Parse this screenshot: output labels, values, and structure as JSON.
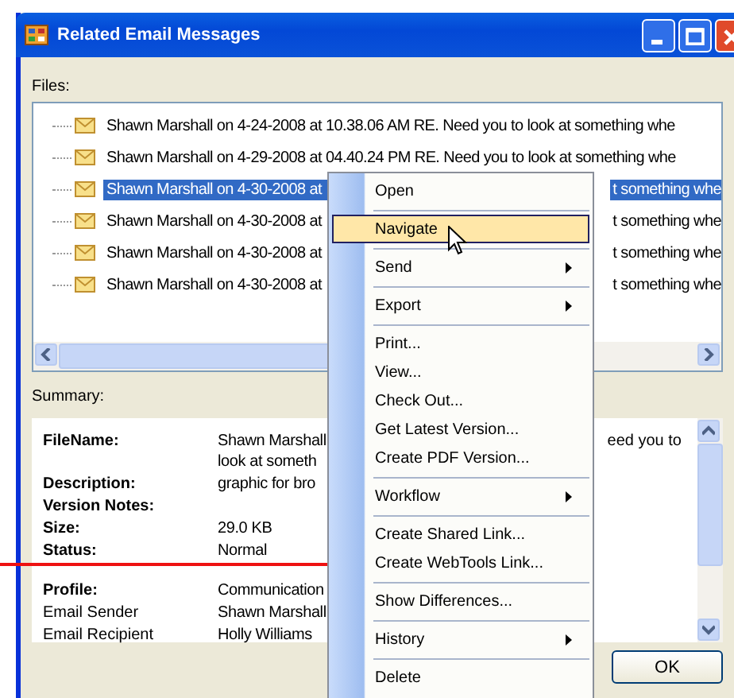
{
  "window": {
    "title": "Related Email Messages"
  },
  "files": {
    "label": "Files:",
    "rows": [
      {
        "text": "Shawn Marshall on 4-24-2008 at 10.38.06 AM RE. Need you to look at something whe",
        "selected": false
      },
      {
        "text": "Shawn Marshall on 4-29-2008 at 04.40.24 PM RE. Need you to look at something whe",
        "selected": false
      },
      {
        "text": "Shawn Marshall on 4-30-2008 at",
        "text_right": "t something whe",
        "selected": true
      },
      {
        "text": "Shawn Marshall on 4-30-2008 at",
        "text_right": "t something whe",
        "selected": false
      },
      {
        "text": "Shawn Marshall on 4-30-2008 at",
        "text_right": "t something whe",
        "selected": false
      },
      {
        "text": "Shawn Marshall on 4-30-2008 at",
        "text_right": "t something whe",
        "selected": false
      }
    ]
  },
  "summary": {
    "label": "Summary:",
    "sections": [
      [
        {
          "name": "FileName:",
          "bold": true,
          "value": [
            "Shawn Marshall",
            "look at someth"
          ],
          "value_right": "eed you to"
        },
        {
          "name": "Description:",
          "bold": true,
          "value": [
            "graphic for bro"
          ]
        },
        {
          "name": "Version Notes:",
          "bold": true
        },
        {
          "name": "Size:",
          "bold": true,
          "value": [
            "29.0 KB"
          ]
        },
        {
          "name": "Status:",
          "bold": true,
          "value": [
            "Normal"
          ]
        }
      ],
      [
        {
          "name": "Profile:",
          "bold": true,
          "value": [
            "Communication"
          ]
        },
        {
          "name": "Email Sender",
          "bold": false,
          "value": [
            "Shawn Marshall"
          ]
        },
        {
          "name": "Email Recipient",
          "bold": false,
          "value": [
            "Holly Williams"
          ]
        }
      ]
    ]
  },
  "ok_button": "OK",
  "context_menu": [
    {
      "label": "Open",
      "highlighted": false,
      "submenu": false,
      "separator": true
    },
    {
      "label": "Navigate",
      "highlighted": true,
      "submenu": false,
      "separator": true
    },
    {
      "label": "Send",
      "highlighted": false,
      "submenu": true,
      "separator": true
    },
    {
      "label": "Export",
      "highlighted": false,
      "submenu": true,
      "separator": true
    },
    {
      "label": "Print...",
      "highlighted": false,
      "submenu": false,
      "separator": false
    },
    {
      "label": "View...",
      "highlighted": false,
      "submenu": false,
      "separator": false
    },
    {
      "label": "Check Out...",
      "highlighted": false,
      "submenu": false,
      "separator": false
    },
    {
      "label": "Get Latest Version...",
      "highlighted": false,
      "submenu": false,
      "separator": false
    },
    {
      "label": "Create PDF Version...",
      "highlighted": false,
      "submenu": false,
      "separator": true
    },
    {
      "label": "Workflow",
      "highlighted": false,
      "submenu": true,
      "separator": true
    },
    {
      "label": "Create Shared Link...",
      "highlighted": false,
      "submenu": false,
      "separator": false
    },
    {
      "label": "Create WebTools Link...",
      "highlighted": false,
      "submenu": false,
      "separator": true
    },
    {
      "label": "Show Differences...",
      "highlighted": false,
      "submenu": false,
      "separator": true
    },
    {
      "label": "History",
      "highlighted": false,
      "submenu": true,
      "separator": true
    },
    {
      "label": "Delete",
      "highlighted": false,
      "submenu": false,
      "separator": false
    }
  ]
}
